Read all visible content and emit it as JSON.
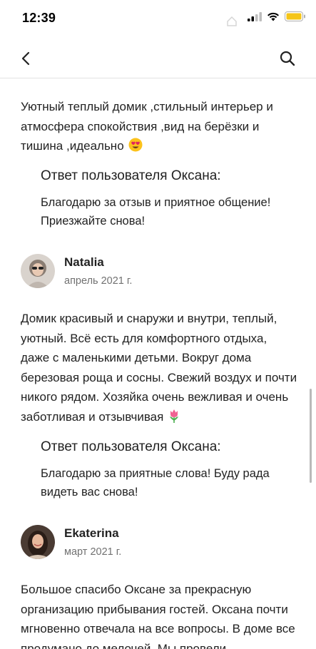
{
  "status_bar": {
    "time": "12:39"
  },
  "icons": {
    "back": "chevron-left-icon",
    "search": "search-icon",
    "signal": "cellular-signal-icon",
    "wifi": "wifi-icon",
    "battery": "battery-icon",
    "home": "home-icon"
  },
  "colors": {
    "battery": "#f5c518",
    "divider": "#e2e2e2",
    "secondary_text": "#717171"
  },
  "reviews": [
    {
      "text": "Уютный теплый домик ,стильный интерьер и атмосфера спокойствия ,вид на берёзки и тишина ,идеально",
      "emoji": "heart-eyes-emoji",
      "reply_title": "Ответ пользователя Оксана:",
      "reply_text": "Благодарю за отзыв и приятное общение! Приезжайте снова!"
    },
    {
      "author": "Natalia",
      "date": "апрель 2021 г.",
      "text": "Домик красивый и снаружи и внутри, теплый, уютный. Всё есть для комфортного отдыха, даже с маленькими детьми. Вокруг дома березовая роща и сосны. Свежий воздух и почти никого рядом. Хозяйка очень вежливая и очень заботливая и отзывчивая",
      "emoji": "tulip-emoji",
      "reply_title": "Ответ пользователя Оксана:",
      "reply_text": "Благодарю за приятные слова! Буду рада видеть вас снова!"
    },
    {
      "author": "Ekaterina",
      "date": "март 2021 г.",
      "text": "Большое спасибо Оксане за прекрасную организацию прибывания гостей. Оксана почти мгновенно отвечала на все вопросы. В доме все продумано до мелочей. Мы провели"
    }
  ]
}
